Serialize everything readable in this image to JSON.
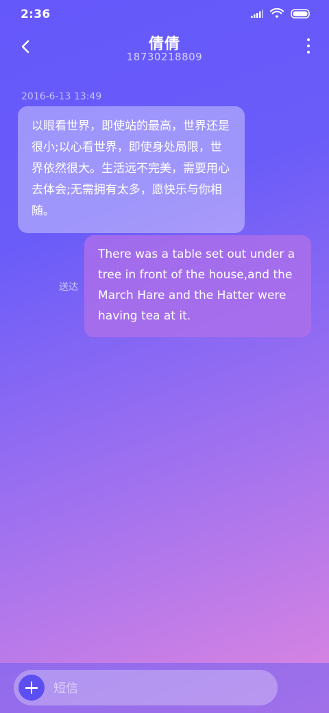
{
  "status_bar": {
    "time": "2:36",
    "icons": [
      "signal-icon",
      "wifi-icon",
      "battery-icon"
    ]
  },
  "header": {
    "contact_name": "倩倩",
    "contact_number": "18730218809",
    "back_icon": "chevron-left-icon",
    "more_icon": "more-vertical-icon"
  },
  "conversation": {
    "timestamp": "2016-6-13 13:49",
    "messages": [
      {
        "direction": "incoming",
        "text": "以眼看世界，即使站的最高，世界还是很小;以心看世界，即使身处局限，世界依然很大。生活远不完美，需要用心去体会;无需拥有太多，愿快乐与你相随。"
      },
      {
        "direction": "outgoing",
        "status": "送达",
        "text": "There was a table set out under a tree in front of the house,and the March Hare and the Hatter were having tea at it."
      }
    ]
  },
  "composer": {
    "add_icon": "plus-icon",
    "placeholder": "短信",
    "value": ""
  },
  "colors": {
    "gradient_top": "#6558fb",
    "gradient_bottom": "#de86e0",
    "add_button": "#5c4ff2"
  }
}
